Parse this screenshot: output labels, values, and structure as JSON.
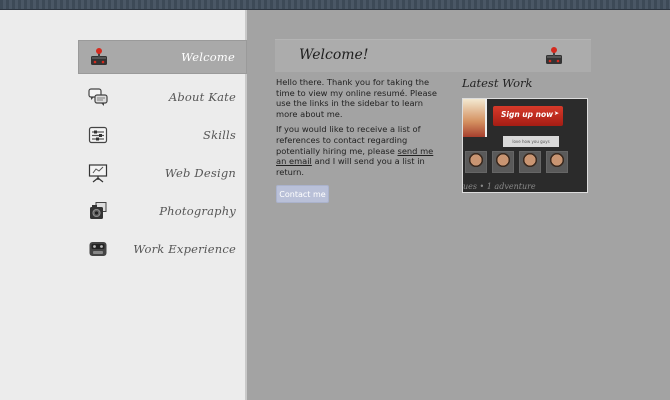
{
  "nav": {
    "items": [
      {
        "label": "Welcome",
        "icon": "joystick-icon",
        "active": true
      },
      {
        "label": "About Kate",
        "icon": "speech-bubbles-icon",
        "active": false
      },
      {
        "label": "Skills",
        "icon": "sliders-icon",
        "active": false
      },
      {
        "label": "Web Design",
        "icon": "presentation-board-icon",
        "active": false
      },
      {
        "label": "Photography",
        "icon": "camera-icon",
        "active": false
      },
      {
        "label": "Work Experience",
        "icon": "robot-face-icon",
        "active": false
      }
    ]
  },
  "header": {
    "title": "Welcome!",
    "icon": "joystick-icon"
  },
  "main": {
    "intro": "Hello there. Thank you for taking the time to view my online resumé. Please use the links in the sidebar to learn more about me.",
    "references_prefix": "If you would like to receive a list of references to contact regarding potentially hiring me, please",
    "email_link": "send me an email",
    "references_suffix": "and I will send you a list in return.",
    "contact_button": "Contact me"
  },
  "latest": {
    "title": "Latest Work",
    "thumb_cta": "Sign up now",
    "thumb_strip": "love how you guys",
    "thumb_caption": "ues  •  1 adventure"
  },
  "colors": {
    "background": "#a3a3a3",
    "sidebar": "#ececec",
    "active_nav": "#a9a9a9",
    "button": "#b9c0d8",
    "topbar": "#3d4a57"
  }
}
